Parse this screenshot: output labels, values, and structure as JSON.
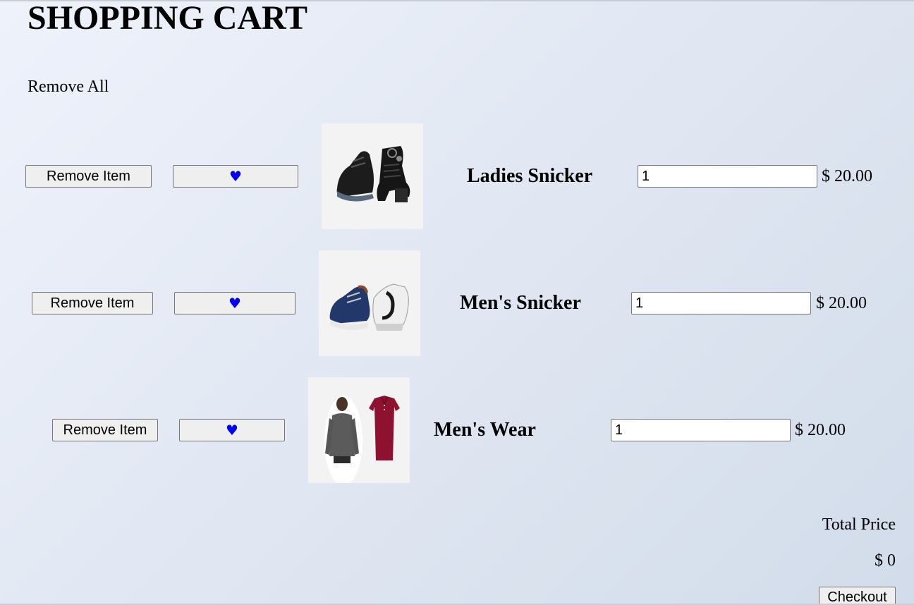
{
  "page": {
    "title": "SHOPPING CART",
    "remove_all_label": "Remove All"
  },
  "cart": {
    "items": [
      {
        "name": "Ladies Snicker",
        "remove_label": "Remove Item",
        "favorite_icon": "♥",
        "quantity": "1",
        "price": "$ 20.00",
        "image_icon": "ladies-sneakers-image"
      },
      {
        "name": "Men's Snicker",
        "remove_label": "Remove Item",
        "favorite_icon": "♥",
        "quantity": "1",
        "price": "$ 20.00",
        "image_icon": "mens-sneakers-image"
      },
      {
        "name": "Men's Wear",
        "remove_label": "Remove Item",
        "favorite_icon": "♥",
        "quantity": "1",
        "price": "$ 20.00",
        "image_icon": "mens-wear-image"
      }
    ]
  },
  "summary": {
    "total_label": "Total Price",
    "total_value": "$ 0",
    "checkout_label": "Checkout"
  },
  "colors": {
    "heart": "#0000ee",
    "button_bg": "#efefef",
    "thumb_bg": "#f3f3f3"
  }
}
